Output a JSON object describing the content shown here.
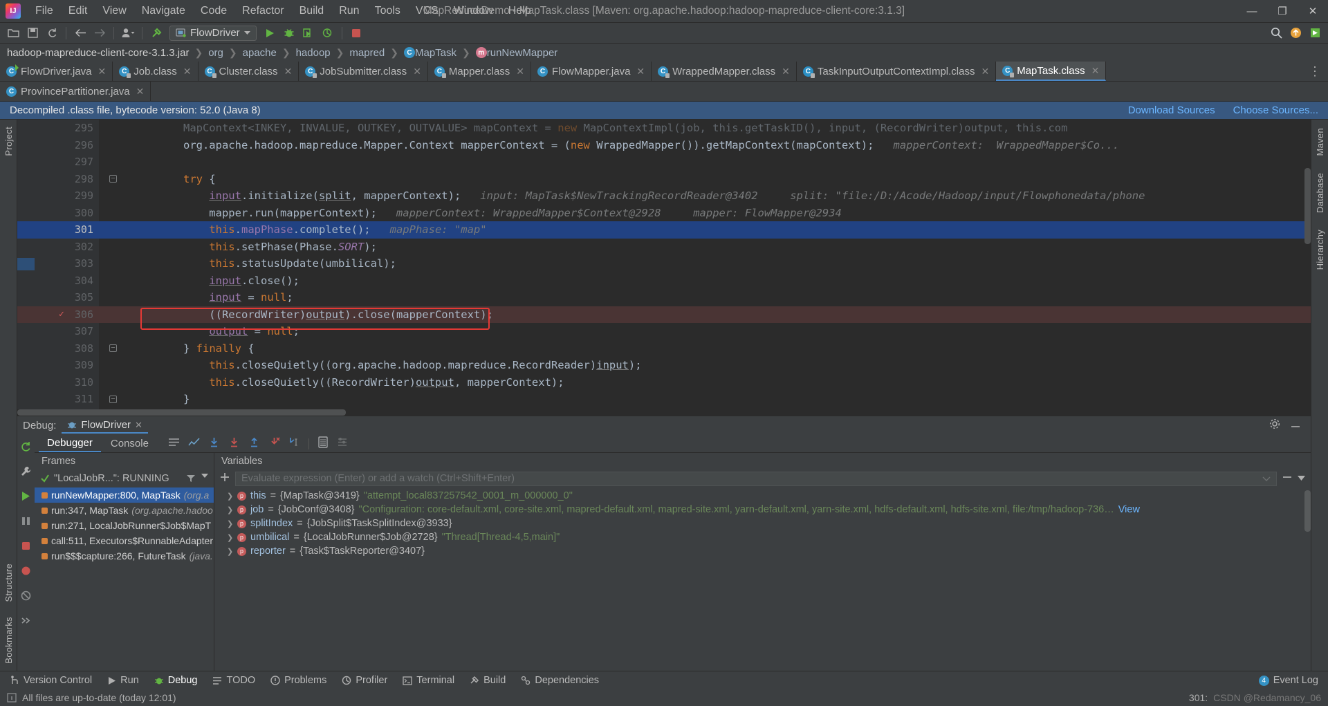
{
  "window": {
    "title": "MapReduceDemo - MapTask.class [Maven: org.apache.hadoop:hadoop-mapreduce-client-core:3.1.3]",
    "minimize": "—",
    "maximize": "❐",
    "close": "✕"
  },
  "menubar": {
    "items": [
      "File",
      "Edit",
      "View",
      "Navigate",
      "Code",
      "Refactor",
      "Build",
      "Run",
      "Tools",
      "VCS",
      "Window",
      "Help"
    ]
  },
  "toolbar": {
    "open_icon": "open-folder-icon",
    "save_icon": "save-icon",
    "sync_icon": "sync-icon",
    "back_icon": "back-arrow-icon",
    "forward_icon": "forward-arrow-icon",
    "profile_icon": "user-icon",
    "build_icon": "hammer-icon",
    "run_config": "FlowDriver",
    "run_icon": "run-icon",
    "debug_icon": "debug-icon",
    "coverage_icon": "coverage-icon",
    "profiler_icon": "profiler-icon",
    "stop_icon": "stop-icon",
    "search_icon": "search-icon",
    "update_icon": "update-icon",
    "ide_icon": "ide-icon"
  },
  "breadcrumb": [
    {
      "label": "hadoop-mapreduce-client-core-3.1.3.jar",
      "icon": ""
    },
    {
      "label": "org",
      "icon": ""
    },
    {
      "label": "apache",
      "icon": ""
    },
    {
      "label": "hadoop",
      "icon": ""
    },
    {
      "label": "mapred",
      "icon": ""
    },
    {
      "label": "MapTask",
      "icon": "C"
    },
    {
      "label": "runNewMapper",
      "icon": "m"
    }
  ],
  "editor_tabs_row1": [
    {
      "label": "FlowDriver.java",
      "active": false,
      "icon": "java-class-runnable-icon"
    },
    {
      "label": "Job.class",
      "active": false,
      "icon": "class-locked-icon"
    },
    {
      "label": "Cluster.class",
      "active": false,
      "icon": "class-locked-icon"
    },
    {
      "label": "JobSubmitter.class",
      "active": false,
      "icon": "class-locked-icon"
    },
    {
      "label": "Mapper.class",
      "active": false,
      "icon": "class-locked-icon"
    },
    {
      "label": "FlowMapper.java",
      "active": false,
      "icon": "java-class-icon"
    },
    {
      "label": "WrappedMapper.class",
      "active": false,
      "icon": "class-locked-icon"
    },
    {
      "label": "TaskInputOutputContextImpl.class",
      "active": false,
      "icon": "class-locked-icon"
    },
    {
      "label": "MapTask.class",
      "active": true,
      "icon": "class-locked-icon"
    }
  ],
  "editor_tabs_row2": [
    {
      "label": "ProvincePartitioner.java",
      "active": false,
      "icon": "java-class-icon"
    }
  ],
  "notice": {
    "text": "Decompiled .class file, bytecode version: 52.0 (Java 8)",
    "download_sources": "Download Sources",
    "choose_sources": "Choose Sources..."
  },
  "code": {
    "lines": [
      {
        "num": "295",
        "cut": true,
        "state": "normal",
        "fold": false,
        "segments": [
          {
            "t": "            MapContext<INKEY, INVALUE, OUTKEY, OUTVALUE> mapContext = ",
            "c": "txt"
          },
          {
            "t": "new",
            "c": "kw"
          },
          {
            "t": " MapContextImpl(job, this.getTaskID(), input, (RecordWriter)output, this.com",
            "c": "txt"
          }
        ]
      },
      {
        "num": "296",
        "cut": false,
        "state": "normal",
        "fold": false,
        "segments": [
          {
            "t": "            org.apache.hadoop.mapreduce.Mapper.Context mapperContext = (",
            "c": "txt"
          },
          {
            "t": "new",
            "c": "kw"
          },
          {
            "t": " WrappedMapper()).getMapContext(mapContext);",
            "c": "txt"
          }
        ],
        "hint": "mapperContext:  WrappedMapper$Co..."
      },
      {
        "num": "297",
        "cut": false,
        "state": "normal",
        "fold": false,
        "segments": []
      },
      {
        "num": "298",
        "cut": false,
        "state": "normal",
        "fold": true,
        "segments": [
          {
            "t": "            ",
            "c": "txt"
          },
          {
            "t": "try",
            "c": "kw"
          },
          {
            "t": " {",
            "c": "txt"
          }
        ]
      },
      {
        "num": "299",
        "cut": false,
        "state": "normal",
        "fold": false,
        "segments": [
          {
            "t": "                ",
            "c": "txt"
          },
          {
            "t": "input",
            "c": "fldu"
          },
          {
            "t": ".initialize(",
            "c": "txt"
          },
          {
            "t": "split",
            "c": "txtu"
          },
          {
            "t": ", mapperContext);",
            "c": "txt"
          }
        ],
        "hint": "input: MapTask$NewTrackingRecordReader@3402     split: \"file:/D:/Acode/Hadoop/input/Flowphonedata/phone"
      },
      {
        "num": "300",
        "cut": false,
        "state": "normal",
        "fold": false,
        "segments": [
          {
            "t": "                mapper.run(mapperContext);",
            "c": "txt"
          }
        ],
        "hint": "mapperContext: WrappedMapper$Context@2928     mapper: FlowMapper@2934"
      },
      {
        "num": "301",
        "cut": false,
        "state": "selected",
        "fold": false,
        "segments": [
          {
            "t": "                ",
            "c": "txt"
          },
          {
            "t": "this",
            "c": "kw"
          },
          {
            "t": ".",
            "c": "txt"
          },
          {
            "t": "mapPhase",
            "c": "fld"
          },
          {
            "t": ".complete();",
            "c": "txt"
          }
        ],
        "hint": "mapPhase: \"map\""
      },
      {
        "num": "302",
        "cut": false,
        "state": "normal",
        "fold": false,
        "segments": [
          {
            "t": "                ",
            "c": "txt"
          },
          {
            "t": "this",
            "c": "kw"
          },
          {
            "t": ".setPhase(Phase.",
            "c": "txt"
          },
          {
            "t": "SORT",
            "c": "fldi"
          },
          {
            "t": ");",
            "c": "txt"
          }
        ]
      },
      {
        "num": "303",
        "cut": false,
        "state": "normal",
        "fold": false,
        "segments": [
          {
            "t": "                ",
            "c": "txt"
          },
          {
            "t": "this",
            "c": "kw"
          },
          {
            "t": ".statusUpdate(umbilical);",
            "c": "txt"
          }
        ]
      },
      {
        "num": "304",
        "cut": false,
        "state": "normal",
        "fold": false,
        "segments": [
          {
            "t": "                ",
            "c": "txt"
          },
          {
            "t": "input",
            "c": "fldu"
          },
          {
            "t": ".close();",
            "c": "txt"
          }
        ]
      },
      {
        "num": "305",
        "cut": false,
        "state": "normal",
        "fold": false,
        "segments": [
          {
            "t": "                ",
            "c": "txt"
          },
          {
            "t": "input",
            "c": "fldu"
          },
          {
            "t": " = ",
            "c": "txt"
          },
          {
            "t": "null",
            "c": "kw"
          },
          {
            "t": ";",
            "c": "txt"
          }
        ]
      },
      {
        "num": "306",
        "cut": false,
        "state": "breakpoint",
        "fold": false,
        "segments": [
          {
            "t": "                ((RecordWriter)",
            "c": "txt"
          },
          {
            "t": "output",
            "c": "txtu"
          },
          {
            "t": ").close(mapperContext);",
            "c": "txt"
          }
        ]
      },
      {
        "num": "307",
        "cut": false,
        "state": "normal",
        "fold": false,
        "segments": [
          {
            "t": "                ",
            "c": "txt"
          },
          {
            "t": "output",
            "c": "fldu"
          },
          {
            "t": " = ",
            "c": "txt"
          },
          {
            "t": "null",
            "c": "kw"
          },
          {
            "t": ";",
            "c": "txt"
          }
        ]
      },
      {
        "num": "308",
        "cut": false,
        "state": "normal",
        "fold": true,
        "segments": [
          {
            "t": "            } ",
            "c": "txt"
          },
          {
            "t": "finally",
            "c": "kw"
          },
          {
            "t": " {",
            "c": "txt"
          }
        ]
      },
      {
        "num": "309",
        "cut": false,
        "state": "normal",
        "fold": false,
        "segments": [
          {
            "t": "                ",
            "c": "txt"
          },
          {
            "t": "this",
            "c": "kw"
          },
          {
            "t": ".closeQuietly((org.apache.hadoop.mapreduce.RecordReader)",
            "c": "txt"
          },
          {
            "t": "input",
            "c": "txtu"
          },
          {
            "t": ");",
            "c": "txt"
          }
        ]
      },
      {
        "num": "310",
        "cut": false,
        "state": "normal",
        "fold": false,
        "segments": [
          {
            "t": "                ",
            "c": "txt"
          },
          {
            "t": "this",
            "c": "kw"
          },
          {
            "t": ".closeQuietly((RecordWriter)",
            "c": "txt"
          },
          {
            "t": "output",
            "c": "txtu"
          },
          {
            "t": ", mapperContext);",
            "c": "txt"
          }
        ]
      },
      {
        "num": "311",
        "cut": false,
        "state": "normal",
        "fold": true,
        "segments": [
          {
            "t": "            }",
            "c": "txt"
          }
        ]
      }
    ]
  },
  "debug": {
    "label": "Debug:",
    "session_tab": "FlowDriver",
    "settings_icon": "gear-icon",
    "minimize_icon": "minimize-icon",
    "tabs": [
      {
        "label": "Debugger",
        "active": true
      },
      {
        "label": "Console",
        "active": false
      }
    ],
    "toolbar_icons": [
      "frames-icon",
      "chart-icon",
      "step-over-icon",
      "step-into-icon",
      "force-step-into-icon",
      "step-out-icon",
      "run-to-cursor-icon",
      "evaluate-icon",
      "mute-breakpoints-icon"
    ],
    "frames_caption": "Frames",
    "thread": "\"LocalJobR...\": RUNNING",
    "frames": [
      {
        "text": "runNewMapper:800, MapTask",
        "italic": "(org.a",
        "selected": true
      },
      {
        "text": "run:347, MapTask",
        "italic": "(org.apache.hadoo",
        "selected": false
      },
      {
        "text": "run:271, LocalJobRunner$Job$MapT",
        "italic": "",
        "selected": false
      },
      {
        "text": "call:511, Executors$RunnableAdapter",
        "italic": "",
        "selected": false
      },
      {
        "text": "run$$$capture:266, FutureTask",
        "italic": "(java.",
        "selected": false
      }
    ],
    "variables_caption": "Variables",
    "watch_placeholder": "Evaluate expression (Enter) or add a watch (Ctrl+Shift+Enter)",
    "add_watch_icon": "plus-icon",
    "remove_watch_icon": "minus-icon",
    "variables": [
      {
        "name": "this",
        "badge": "p",
        "eq": " = ",
        "value": "{MapTask@3419} ",
        "str": "\"attempt_local837257542_0001_m_000000_0\"",
        "more": ""
      },
      {
        "name": "job",
        "badge": "p",
        "eq": " = ",
        "value": "{JobConf@3408} ",
        "str": "\"Configuration: core-default.xml, core-site.xml, mapred-default.xml, mapred-site.xml, yarn-default.xml, yarn-site.xml, hdfs-default.xml, hdfs-site.xml, file:/tmp/hadoop-736…",
        "more": "View"
      },
      {
        "name": "splitIndex",
        "badge": "p",
        "eq": " = ",
        "value": "{JobSplit$TaskSplitIndex@3933}",
        "str": "",
        "more": ""
      },
      {
        "name": "umbilical",
        "badge": "p",
        "eq": " = ",
        "value": "{LocalJobRunner$Job@2728} ",
        "str": "\"Thread[Thread-4,5,main]\"",
        "more": ""
      },
      {
        "name": "reporter",
        "badge": "p",
        "eq": " = ",
        "value": "{Task$TaskReporter@3407}",
        "str": "",
        "more": ""
      }
    ]
  },
  "left_tool_labels": [
    "Project"
  ],
  "left_bottom_labels": [
    "Structure",
    "Bookmarks"
  ],
  "right_tool_labels": [
    "Maven",
    "Database",
    "Hierarchy"
  ],
  "statusbar": {
    "items": [
      {
        "label": "Version Control",
        "icon": "branch-icon",
        "active": false
      },
      {
        "label": "Run",
        "icon": "run-icon",
        "active": false
      },
      {
        "label": "Debug",
        "icon": "debug-icon",
        "active": true
      },
      {
        "label": "TODO",
        "icon": "todo-icon",
        "active": false
      },
      {
        "label": "Problems",
        "icon": "problems-icon",
        "active": false
      },
      {
        "label": "Profiler",
        "icon": "profiler-icon",
        "active": false
      },
      {
        "label": "Terminal",
        "icon": "terminal-icon",
        "active": false
      },
      {
        "label": "Build",
        "icon": "build-icon",
        "active": false
      },
      {
        "label": "Dependencies",
        "icon": "dependencies-icon",
        "active": false
      }
    ],
    "event_log": "Event Log",
    "event_count": "4",
    "message": "All files are up-to-date (today 12:01)",
    "caret": "301:",
    "watermark": "CSDN @Redamancy_06"
  },
  "colors": {
    "accent": "#4a88c7",
    "breakpoint": "#db5c5c",
    "selection": "#214283",
    "notice_bg": "#385880",
    "highlight_box": "#e53935"
  }
}
